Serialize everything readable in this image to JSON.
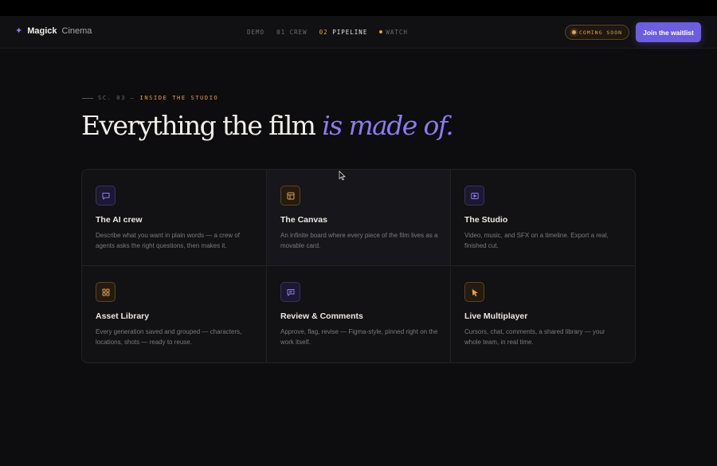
{
  "nav": {
    "brand_bold": "Magick",
    "brand_light": "Cinema",
    "links": [
      {
        "label": "DEMO"
      },
      {
        "label": "01 CREW"
      },
      {
        "num": "02",
        "label": "PIPELINE"
      },
      {
        "label": "WATCH"
      }
    ],
    "badge": "COMING SOON",
    "cta": "Join the waitlist"
  },
  "hero": {
    "eyebrow_prefix": "SC. 03 —",
    "eyebrow_section": "INSIDE THE STUDIO",
    "headline_plain": "Everything the film ",
    "headline_accent": "is made of."
  },
  "features": [
    {
      "title": "The AI crew",
      "desc": "Describe what you want in plain words — a crew of agents asks the right questions, then makes it.",
      "icon": "chat-bubble-icon"
    },
    {
      "title": "The Canvas",
      "desc": "An infinite board where every piece of the film lives as a movable card.",
      "icon": "layout-board-icon"
    },
    {
      "title": "The Studio",
      "desc": "Video, music, and SFX on a timeline. Export a real, finished cut.",
      "icon": "play-icon"
    },
    {
      "title": "Asset Library",
      "desc": "Every generation saved and grouped — characters, locations, shots — ready to reuse.",
      "icon": "grid-icon"
    },
    {
      "title": "Review & Comments",
      "desc": "Approve, flag, revise — Figma-style, pinned right on the work itself.",
      "icon": "comment-icon"
    },
    {
      "title": "Live Multiplayer",
      "desc": "Cursors, chat, comments, a shared library — your whole team, in real time.",
      "icon": "cursor-icon"
    }
  ],
  "colors": {
    "accent_violet": "#8b7cf0",
    "accent_amber": "#e3a24a",
    "cta_bg": "#6d5de0",
    "background": "#0d0c0e"
  }
}
